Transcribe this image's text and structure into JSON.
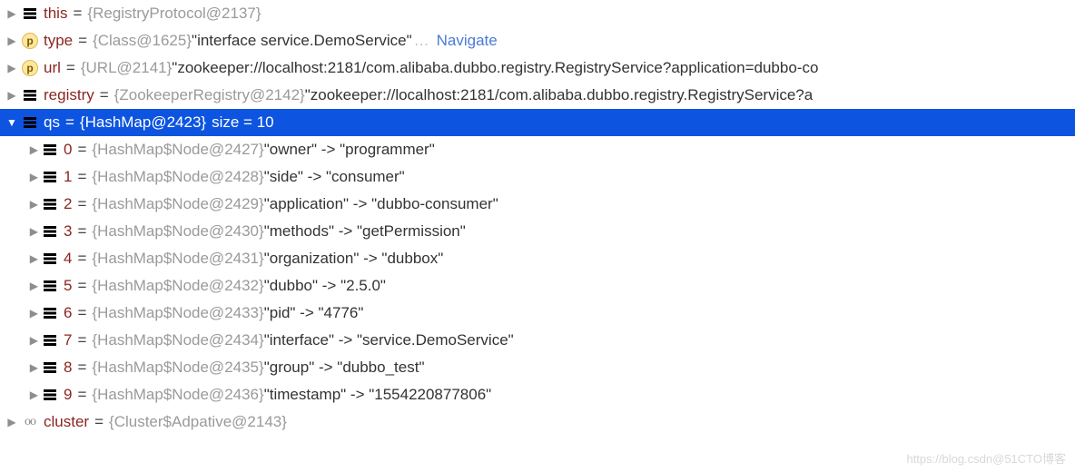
{
  "rows": [
    {
      "indent": 0,
      "arrow": "right",
      "icon": "field",
      "name": "this",
      "eq": "=",
      "type": "{RegistryProtocol@2137}",
      "value": "",
      "extra": "",
      "link": "",
      "selected": false
    },
    {
      "indent": 0,
      "arrow": "right",
      "icon": "p",
      "name": "type",
      "eq": "=",
      "type": "{Class@1625}",
      "value": " \"interface service.DemoService\"",
      "extra": "",
      "ellipsis": "…",
      "link": "Navigate",
      "selected": false
    },
    {
      "indent": 0,
      "arrow": "right",
      "icon": "p",
      "name": "url",
      "eq": "=",
      "type": "{URL@2141}",
      "value": " \"zookeeper://localhost:2181/com.alibaba.dubbo.registry.RegistryService?application=dubbo-co",
      "extra": "",
      "link": "",
      "selected": false
    },
    {
      "indent": 0,
      "arrow": "right",
      "icon": "field",
      "name": "registry",
      "eq": "=",
      "type": "{ZookeeperRegistry@2142}",
      "value": " \"zookeeper://localhost:2181/com.alibaba.dubbo.registry.RegistryService?a",
      "extra": "",
      "link": "",
      "selected": false
    },
    {
      "indent": 0,
      "arrow": "down",
      "icon": "field",
      "name": "qs",
      "eq": "=",
      "type": "{HashMap@2423}",
      "value": "",
      "extra": " size = 10",
      "link": "",
      "selected": true
    },
    {
      "indent": 1,
      "arrow": "right",
      "icon": "field",
      "name": "0",
      "eq": "=",
      "type": "{HashMap$Node@2427}",
      "value": " \"owner\" -> \"programmer\"",
      "extra": "",
      "link": "",
      "selected": false
    },
    {
      "indent": 1,
      "arrow": "right",
      "icon": "field",
      "name": "1",
      "eq": "=",
      "type": "{HashMap$Node@2428}",
      "value": " \"side\" -> \"consumer\"",
      "extra": "",
      "link": "",
      "selected": false
    },
    {
      "indent": 1,
      "arrow": "right",
      "icon": "field",
      "name": "2",
      "eq": "=",
      "type": "{HashMap$Node@2429}",
      "value": " \"application\" -> \"dubbo-consumer\"",
      "extra": "",
      "link": "",
      "selected": false
    },
    {
      "indent": 1,
      "arrow": "right",
      "icon": "field",
      "name": "3",
      "eq": "=",
      "type": "{HashMap$Node@2430}",
      "value": " \"methods\" -> \"getPermission\"",
      "extra": "",
      "link": "",
      "selected": false
    },
    {
      "indent": 1,
      "arrow": "right",
      "icon": "field",
      "name": "4",
      "eq": "=",
      "type": "{HashMap$Node@2431}",
      "value": " \"organization\" -> \"dubbox\"",
      "extra": "",
      "link": "",
      "selected": false
    },
    {
      "indent": 1,
      "arrow": "right",
      "icon": "field",
      "name": "5",
      "eq": "=",
      "type": "{HashMap$Node@2432}",
      "value": " \"dubbo\" -> \"2.5.0\"",
      "extra": "",
      "link": "",
      "selected": false
    },
    {
      "indent": 1,
      "arrow": "right",
      "icon": "field",
      "name": "6",
      "eq": "=",
      "type": "{HashMap$Node@2433}",
      "value": " \"pid\" -> \"4776\"",
      "extra": "",
      "link": "",
      "selected": false
    },
    {
      "indent": 1,
      "arrow": "right",
      "icon": "field",
      "name": "7",
      "eq": "=",
      "type": "{HashMap$Node@2434}",
      "value": " \"interface\" -> \"service.DemoService\"",
      "extra": "",
      "link": "",
      "selected": false
    },
    {
      "indent": 1,
      "arrow": "right",
      "icon": "field",
      "name": "8",
      "eq": "=",
      "type": "{HashMap$Node@2435}",
      "value": " \"group\" -> \"dubbo_test\"",
      "extra": "",
      "link": "",
      "selected": false
    },
    {
      "indent": 1,
      "arrow": "right",
      "icon": "field",
      "name": "9",
      "eq": "=",
      "type": "{HashMap$Node@2436}",
      "value": " \"timestamp\" -> \"1554220877806\"",
      "extra": "",
      "link": "",
      "selected": false
    },
    {
      "indent": 0,
      "arrow": "right",
      "icon": "oo",
      "name": "cluster",
      "eq": "=",
      "type": "{Cluster$Adpative@2143}",
      "value": "",
      "extra": "",
      "link": "",
      "selected": false
    }
  ],
  "watermark": "https://blog.csdn@51CTO博客"
}
